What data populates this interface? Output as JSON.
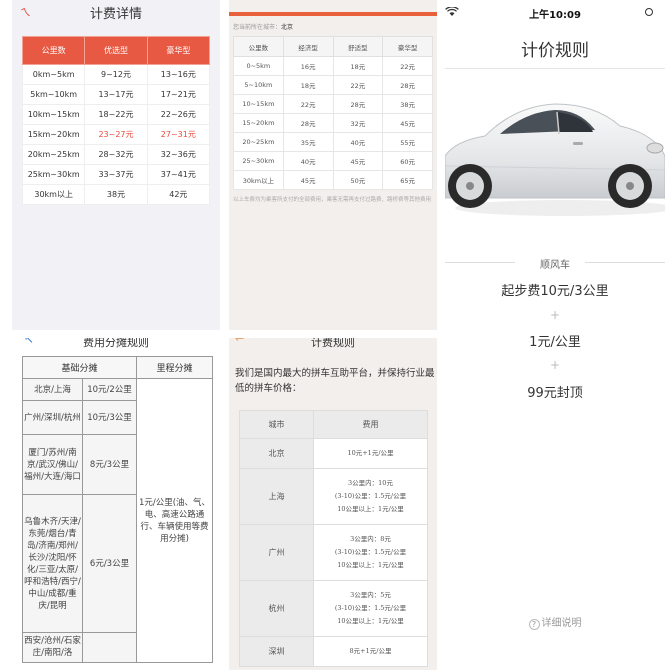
{
  "panel1": {
    "title": "计费详情",
    "back_glyph": "ㄟ",
    "headers": [
      "公里数",
      "优选型",
      "豪华型"
    ],
    "rows": [
      [
        "0km~5km",
        "9~12元",
        "13~16元"
      ],
      [
        "5km~10km",
        "13~17元",
        "17~21元"
      ],
      [
        "10km~15km",
        "18~22元",
        "22~26元"
      ],
      [
        "15km~20km",
        "23~27元",
        "27~31元"
      ],
      [
        "20km~25km",
        "28~32元",
        "32~36元"
      ],
      [
        "25km~30km",
        "33~37元",
        "37~41元"
      ],
      [
        "30km以上",
        "38元",
        "42元"
      ]
    ],
    "highlight_row": 3,
    "accent": "#e85943"
  },
  "panel2": {
    "city_label": "您当前所在城市：",
    "city_value": "北京",
    "headers": [
      "公里数",
      "经济型",
      "舒适型",
      "豪华型"
    ],
    "rows": [
      [
        "0~5km",
        "16元",
        "18元",
        "22元"
      ],
      [
        "5~10km",
        "18元",
        "22元",
        "28元"
      ],
      [
        "10~15km",
        "22元",
        "28元",
        "38元"
      ],
      [
        "15~20km",
        "28元",
        "32元",
        "45元"
      ],
      [
        "20~25km",
        "35元",
        "40元",
        "55元"
      ],
      [
        "25~30km",
        "40元",
        "45元",
        "60元"
      ],
      [
        "30km以上",
        "45元",
        "50元",
        "65元"
      ]
    ],
    "note": "以上车费均为乘客所支付的全部费用，乘客无需再支付过路费、路桥费等其他费用"
  },
  "panel3": {
    "title": "费用分摊规则",
    "headers": [
      "基础分摊",
      "里程分摊"
    ],
    "rows": [
      {
        "city": "北京/上海",
        "rate": "10元/2公里"
      },
      {
        "city": "广州/深圳/杭州",
        "rate": "10元/3公里"
      },
      {
        "city": "厦门/苏州/南京/武汉/佛山/福州/大连/海口",
        "rate": "8元/3公里"
      },
      {
        "city": "乌鲁木齐/天津/东莞/烟台/青岛/济南/郑州/长沙/沈阳/怀化/三亚/太原/呼和浩特/西宁/中山/成都/重庆/昆明",
        "rate": "6元/3公里"
      },
      {
        "city": "西安/沧州/石家庄/南阳/洛",
        "rate": ""
      }
    ],
    "mileage": "1元/公里(油、气、电、高速公路通行、车辆使用等费用分摊)"
  },
  "panel4": {
    "title": "计费规则",
    "intro": "我们是国内最大的拼车互助平台，并保持行业最低的拼车价格：",
    "headers": [
      "城市",
      "费用"
    ],
    "rows": [
      {
        "city": "北京",
        "lines": [
          "10元+1元/公里"
        ]
      },
      {
        "city": "上海",
        "lines": [
          "3公里内：10元",
          "(3-10)公里：1.5元/公里",
          "10公里以上：1元/公里"
        ]
      },
      {
        "city": "广州",
        "lines": [
          "3公里内：8元",
          "(3-10)公里：1.5元/公里",
          "10公里以上：1元/公里"
        ]
      },
      {
        "city": "杭州",
        "lines": [
          "3公里内：5元",
          "(3-10)公里：1.5元/公里",
          "10公里以上：1元/公里"
        ]
      },
      {
        "city": "深圳",
        "lines": [
          "8元+1元/公里"
        ]
      }
    ]
  },
  "panel5": {
    "time": "上午10:09",
    "title": "计价规则",
    "section": "顺风车",
    "start_fee": "起步费10元/3公里",
    "plus1": "+",
    "per_km": "1元/公里",
    "plus2": "+",
    "cap": "99元封顶",
    "detail": "详细说明",
    "detail_icon": "?"
  }
}
